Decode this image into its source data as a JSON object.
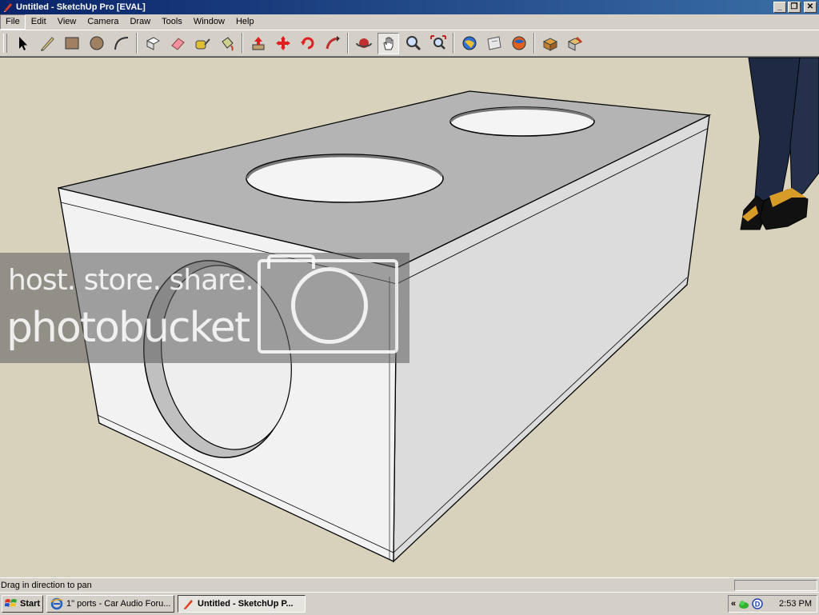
{
  "window": {
    "title": "Untitled - SketchUp Pro [EVAL]",
    "controls": {
      "minimize": "_",
      "maximize": "❐",
      "close": "✕"
    }
  },
  "menu": {
    "items": [
      "File",
      "Edit",
      "View",
      "Camera",
      "Draw",
      "Tools",
      "Window",
      "Help"
    ],
    "active": "File"
  },
  "toolbar": {
    "groups": [
      [
        "select-icon",
        "pencil-line-icon",
        "rectangle-icon",
        "circle-icon",
        "arc-icon"
      ],
      [
        "make-component-icon",
        "eraser-icon",
        "tape-measure-icon",
        "paint-bucket-icon"
      ],
      [
        "push-pull-icon",
        "move-icon",
        "rotate-icon",
        "follow-me-icon"
      ],
      [
        "orbit-icon",
        "pan-icon",
        "zoom-icon",
        "zoom-extents-icon"
      ],
      [
        "get-models-icon",
        "share-model-icon",
        "google-earth-icon"
      ],
      [
        "components-icon",
        "styles-icon"
      ]
    ],
    "pressed": "pan-icon"
  },
  "viewport": {
    "background": "#d8d2bc",
    "watermark": {
      "line1": "host. store. share.",
      "line2": "photobucket"
    }
  },
  "status": {
    "message": "Drag in direction to pan",
    "measurements": ""
  },
  "taskbar": {
    "start_label": "Start",
    "tasks": [
      {
        "label": "1\" ports - Car Audio Foru...",
        "icon": "internet-explorer-icon",
        "active": false
      },
      {
        "label": "Untitled - SketchUp P...",
        "icon": "sketchup-icon",
        "active": true
      }
    ],
    "tray": {
      "chevron": "«",
      "clock": "2:53 PM"
    }
  },
  "colors": {
    "titlebar_start": "#0a246a",
    "titlebar_end": "#3a6ea5",
    "chrome": "#d4d0c8",
    "box_top": "#b4b4b4",
    "box_front": "#f2f2f2",
    "box_side": "#dcdcdc"
  }
}
